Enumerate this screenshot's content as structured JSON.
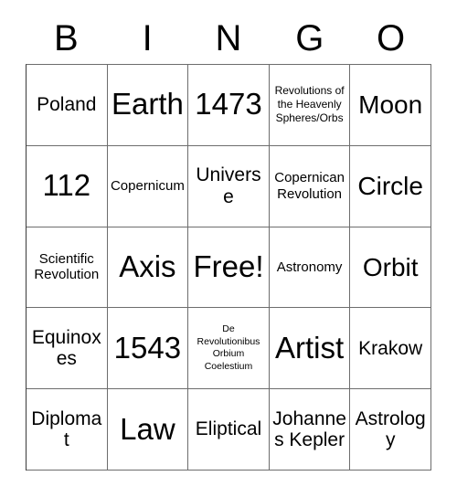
{
  "card": {
    "title": "Bingo Card",
    "header_letters": [
      "B",
      "I",
      "N",
      "G",
      "O"
    ],
    "columns": 5,
    "rows": 5,
    "free_space_label": "Free!",
    "colors": {
      "background": "#ffffff",
      "text": "#000000",
      "grid_line": "#6d6d6d"
    },
    "grid": [
      [
        {
          "text": "Poland",
          "size": "md"
        },
        {
          "text": "Earth",
          "size": "xl"
        },
        {
          "text": "1473",
          "size": "xl"
        },
        {
          "text": "Revolutions of the Heavenly Spheres/Orbs",
          "size": "xs"
        },
        {
          "text": "Moon",
          "size": "lg"
        }
      ],
      [
        {
          "text": "112",
          "size": "xl"
        },
        {
          "text": "Copernicum",
          "size": "sm"
        },
        {
          "text": "Universe",
          "size": "md"
        },
        {
          "text": "Copernican Revolution",
          "size": "sm"
        },
        {
          "text": "Circle",
          "size": "lg"
        }
      ],
      [
        {
          "text": "Scientific Revolution",
          "size": "sm"
        },
        {
          "text": "Axis",
          "size": "xl"
        },
        {
          "text": "Free!",
          "size": "xl"
        },
        {
          "text": "Astronomy",
          "size": "sm"
        },
        {
          "text": "Orbit",
          "size": "lg"
        }
      ],
      [
        {
          "text": "Equinoxes",
          "size": "md"
        },
        {
          "text": "1543",
          "size": "xl"
        },
        {
          "text": "De Revolutionibus Orbium Coelestium",
          "size": "xxs"
        },
        {
          "text": "Artist",
          "size": "xl"
        },
        {
          "text": "Krakow",
          "size": "md"
        }
      ],
      [
        {
          "text": "Diplomat",
          "size": "md"
        },
        {
          "text": "Law",
          "size": "xl"
        },
        {
          "text": "Eliptical",
          "size": "md"
        },
        {
          "text": "Johannes Kepler",
          "size": "md"
        },
        {
          "text": "Astrology",
          "size": "md"
        }
      ]
    ]
  }
}
